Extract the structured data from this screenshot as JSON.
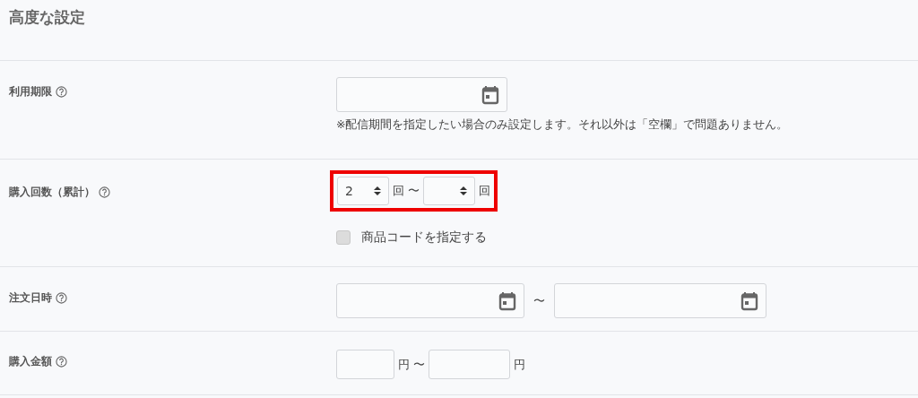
{
  "heading": "高度な設定",
  "rows": [
    {
      "kind": "date",
      "label": "利用期限",
      "note": "※配信期間を指定したい場合のみ設定します。それ以外は「空欄」で問題ありません。"
    },
    {
      "kind": "count",
      "label": "購入回数（累計）",
      "highlighted": true,
      "from_value": "2",
      "unit_from": "回",
      "separator": "〜",
      "unit_to": "回",
      "checkbox": {
        "label": "商品コードを指定する",
        "checked": false
      }
    },
    {
      "kind": "date_range",
      "label": "注文日時",
      "separator": "〜"
    },
    {
      "kind": "amount",
      "label": "購入金額",
      "unit_from": "円",
      "separator": "〜",
      "unit_to": "円"
    }
  ]
}
